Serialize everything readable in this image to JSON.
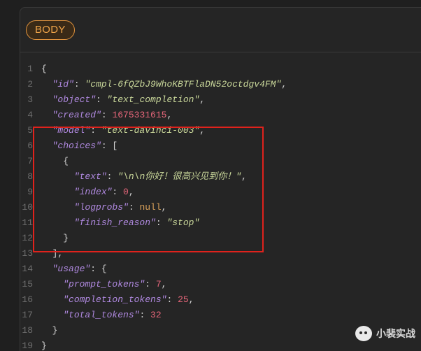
{
  "section": {
    "badge": "BODY"
  },
  "code": {
    "lines": [
      {
        "n": "1",
        "tokens": [
          {
            "c": "p",
            "t": "{"
          }
        ]
      },
      {
        "n": "2",
        "tokens": [
          {
            "c": "p",
            "t": "  "
          },
          {
            "c": "k",
            "t": "\"id\""
          },
          {
            "c": "p",
            "t": ": "
          },
          {
            "c": "s",
            "t": "\"cmpl-6fQZbJ9WhoKBTFlaDN52octdgv4FM\""
          },
          {
            "c": "p",
            "t": ","
          }
        ]
      },
      {
        "n": "3",
        "tokens": [
          {
            "c": "p",
            "t": "  "
          },
          {
            "c": "k",
            "t": "\"object\""
          },
          {
            "c": "p",
            "t": ": "
          },
          {
            "c": "s",
            "t": "\"text_completion\""
          },
          {
            "c": "p",
            "t": ","
          }
        ]
      },
      {
        "n": "4",
        "tokens": [
          {
            "c": "p",
            "t": "  "
          },
          {
            "c": "k",
            "t": "\"created\""
          },
          {
            "c": "p",
            "t": ": "
          },
          {
            "c": "n",
            "t": "1675331615"
          },
          {
            "c": "p",
            "t": ","
          }
        ]
      },
      {
        "n": "5",
        "tokens": [
          {
            "c": "p",
            "t": "  "
          },
          {
            "c": "k",
            "t": "\"model\""
          },
          {
            "c": "p",
            "t": ": "
          },
          {
            "c": "s",
            "t": "\"text-davinci-003\""
          },
          {
            "c": "p",
            "t": ","
          }
        ]
      },
      {
        "n": "6",
        "tokens": [
          {
            "c": "p",
            "t": "  "
          },
          {
            "c": "k",
            "t": "\"choices\""
          },
          {
            "c": "p",
            "t": ": ["
          }
        ]
      },
      {
        "n": "7",
        "tokens": [
          {
            "c": "p",
            "t": "    {"
          }
        ]
      },
      {
        "n": "8",
        "tokens": [
          {
            "c": "p",
            "t": "      "
          },
          {
            "c": "k",
            "t": "\"text\""
          },
          {
            "c": "p",
            "t": ": "
          },
          {
            "c": "s",
            "t": "\"\\n\\n你好！很高兴见到你！\""
          },
          {
            "c": "p",
            "t": ","
          }
        ]
      },
      {
        "n": "9",
        "tokens": [
          {
            "c": "p",
            "t": "      "
          },
          {
            "c": "k",
            "t": "\"index\""
          },
          {
            "c": "p",
            "t": ": "
          },
          {
            "c": "n",
            "t": "0"
          },
          {
            "c": "p",
            "t": ","
          }
        ]
      },
      {
        "n": "10",
        "tokens": [
          {
            "c": "p",
            "t": "      "
          },
          {
            "c": "k",
            "t": "\"logprobs\""
          },
          {
            "c": "p",
            "t": ": "
          },
          {
            "c": "kw",
            "t": "null"
          },
          {
            "c": "p",
            "t": ","
          }
        ]
      },
      {
        "n": "11",
        "tokens": [
          {
            "c": "p",
            "t": "      "
          },
          {
            "c": "k",
            "t": "\"finish_reason\""
          },
          {
            "c": "p",
            "t": ": "
          },
          {
            "c": "s",
            "t": "\"stop\""
          }
        ]
      },
      {
        "n": "12",
        "tokens": [
          {
            "c": "p",
            "t": "    }"
          }
        ]
      },
      {
        "n": "13",
        "tokens": [
          {
            "c": "p",
            "t": "  ],"
          }
        ]
      },
      {
        "n": "14",
        "tokens": [
          {
            "c": "p",
            "t": "  "
          },
          {
            "c": "k",
            "t": "\"usage\""
          },
          {
            "c": "p",
            "t": ": {"
          }
        ]
      },
      {
        "n": "15",
        "tokens": [
          {
            "c": "p",
            "t": "    "
          },
          {
            "c": "k",
            "t": "\"prompt_tokens\""
          },
          {
            "c": "p",
            "t": ": "
          },
          {
            "c": "n",
            "t": "7"
          },
          {
            "c": "p",
            "t": ","
          }
        ]
      },
      {
        "n": "16",
        "tokens": [
          {
            "c": "p",
            "t": "    "
          },
          {
            "c": "k",
            "t": "\"completion_tokens\""
          },
          {
            "c": "p",
            "t": ": "
          },
          {
            "c": "n",
            "t": "25"
          },
          {
            "c": "p",
            "t": ","
          }
        ]
      },
      {
        "n": "17",
        "tokens": [
          {
            "c": "p",
            "t": "    "
          },
          {
            "c": "k",
            "t": "\"total_tokens\""
          },
          {
            "c": "p",
            "t": ": "
          },
          {
            "c": "n",
            "t": "32"
          }
        ]
      },
      {
        "n": "18",
        "tokens": [
          {
            "c": "p",
            "t": "  }"
          }
        ]
      },
      {
        "n": "19",
        "tokens": [
          {
            "c": "p",
            "t": "}"
          }
        ]
      }
    ]
  },
  "watermark": {
    "text": "小裴实战",
    "icon": "wechat-icon"
  },
  "colors": {
    "background": "#252525",
    "key": "#b089e0",
    "string": "#c9d79a",
    "number": "#e6667a",
    "null": "#d9a15a",
    "badge": "#f0a54a",
    "highlight": "#e0221c"
  }
}
